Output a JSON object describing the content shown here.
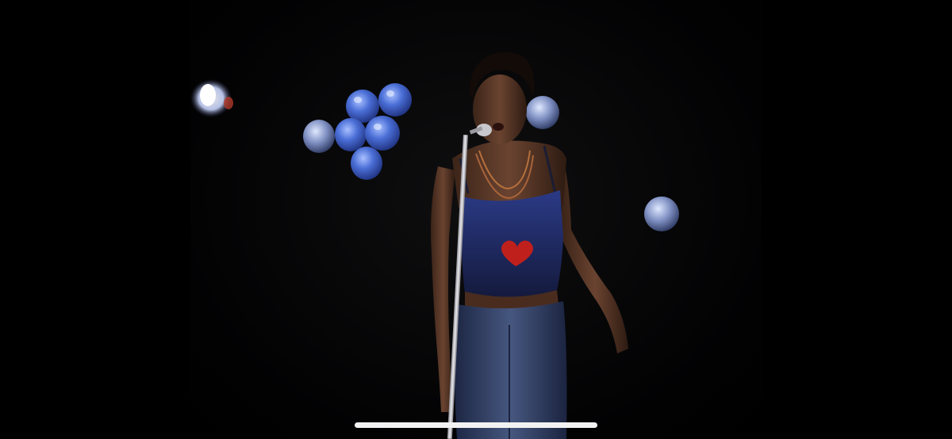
{
  "screen": {
    "background_color": "#000000"
  },
  "video": {
    "content": "performer-singing-at-microphone",
    "colors": {
      "stage_background": "#050506",
      "balloon_blue": "#3f63c9",
      "top_navy": "#1a2350",
      "jeans_blue": "#2f3f66",
      "heart_red": "#c0201c"
    }
  },
  "system": {
    "home_indicator_color": "#f2f2f2"
  }
}
